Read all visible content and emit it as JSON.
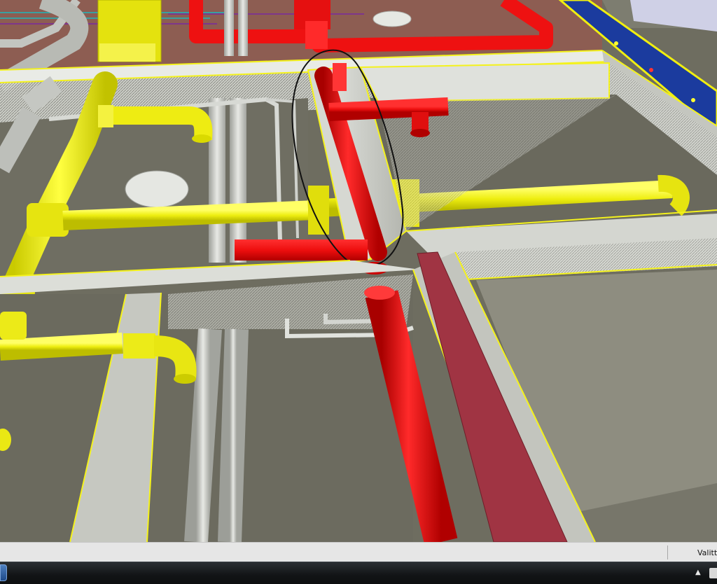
{
  "viewport": {
    "description_annotation": "hand-drawn-ellipse",
    "colors": {
      "background": "#6e6d60",
      "wall": "#c9cbc4",
      "wall_edge": "#f2f22a",
      "yellow_pipe": "#f0ee0e",
      "red_pipe": "#ee1010",
      "grey_pipe": "#c3c5c0",
      "brown_duct": "#a23440",
      "blue_tray": "#1a3aa0",
      "ceiling": "#8a5a50",
      "annotation": "#111111"
    }
  },
  "statusbar": {
    "text": "Valittu"
  },
  "taskbar": {
    "tray_arrow": "▲",
    "start_icon": "windows-start-icon",
    "tray_icon": "tray-app-icon"
  }
}
